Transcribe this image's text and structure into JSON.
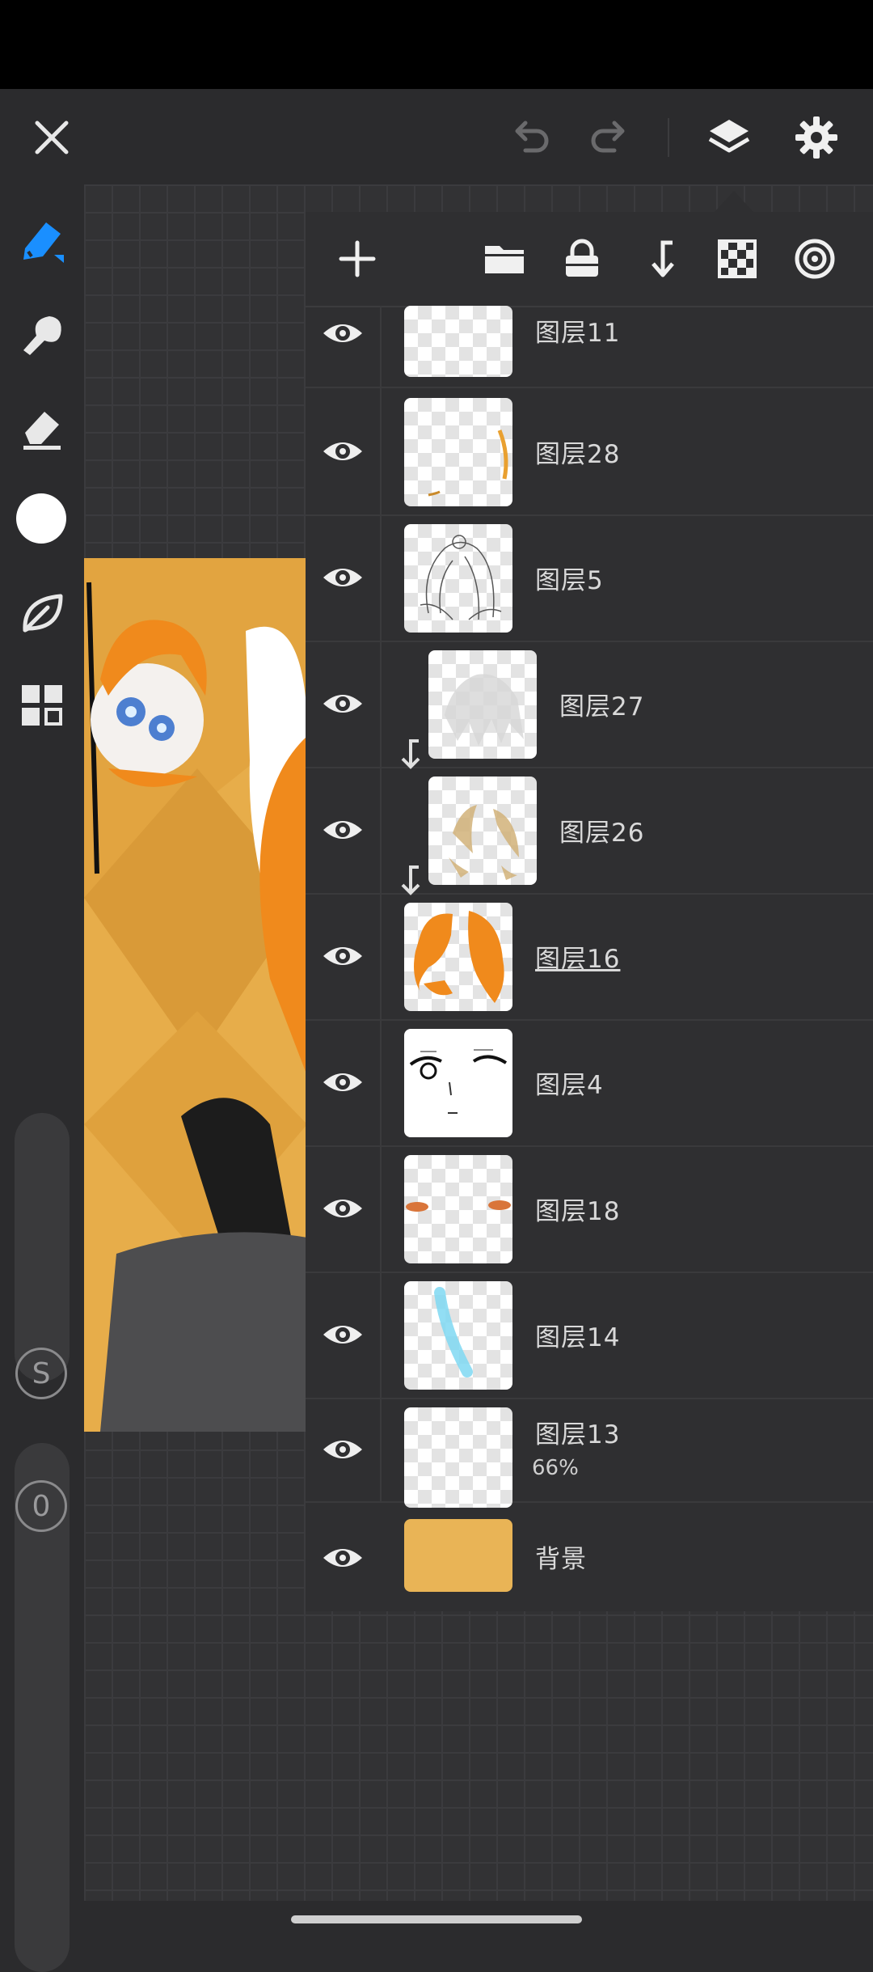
{
  "toolbar": {
    "close_icon": "close-icon",
    "undo_icon": "undo-icon",
    "redo_icon": "redo-icon",
    "layers_icon": "layers-icon",
    "settings_icon": "gear-icon"
  },
  "tools": [
    "pen-icon",
    "smudge-icon",
    "eraser-icon",
    "color-swatch",
    "leaf-icon",
    "grid-icon"
  ],
  "sliders": {
    "size_label": "S",
    "opacity_label": "0"
  },
  "panel_tools": [
    "add-layer-icon",
    "folder-icon",
    "lock-icon",
    "clip-down-icon",
    "checker-icon",
    "blend-mode-icon"
  ],
  "layers": [
    {
      "name": "图层11"
    },
    {
      "name": "图层28"
    },
    {
      "name": "图层5"
    },
    {
      "name": "图层27",
      "clipped": true
    },
    {
      "name": "图层26",
      "clipped": true
    },
    {
      "name": "图层16",
      "selected": true
    },
    {
      "name": "图层4"
    },
    {
      "name": "图层18"
    },
    {
      "name": "图层14"
    },
    {
      "name": "图层13",
      "opacity": "66%"
    },
    {
      "name": "背景"
    }
  ],
  "colors": {
    "background_fill": "#e9b456",
    "accent": "#1a8fff"
  }
}
